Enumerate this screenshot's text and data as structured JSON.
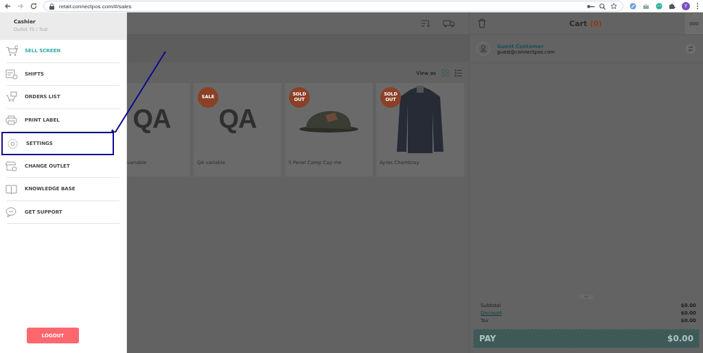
{
  "browser": {
    "url": "retail.connectpos.com/#/sales",
    "profile_initial": "Y"
  },
  "drawer": {
    "user": "Cashier",
    "outlet": "Outlet 75 / Test",
    "items": [
      {
        "label": "SELL SCREEN",
        "selected": true,
        "highlighted": false
      },
      {
        "label": "SHIFTS",
        "selected": false,
        "highlighted": false
      },
      {
        "label": "ORDERS LIST",
        "selected": false,
        "highlighted": false
      },
      {
        "label": "PRINT LABEL",
        "selected": false,
        "highlighted": false
      },
      {
        "label": "SETTINGS",
        "selected": false,
        "highlighted": true
      },
      {
        "label": "CHANGE OUTLET",
        "selected": false,
        "highlighted": false
      },
      {
        "label": "KNOWLEDGE BASE",
        "selected": false,
        "highlighted": false
      },
      {
        "label": "GET SUPPORT",
        "selected": false,
        "highlighted": false
      }
    ],
    "logout": "LOGOUT"
  },
  "products": {
    "view_as": "View as",
    "items": [
      {
        "name": "variable",
        "image_text": "QA"
      },
      {
        "name": "QA variable",
        "image_text": "QA",
        "badge": "SALE"
      },
      {
        "name": "5 Panel Camp Cap me",
        "badge": "SOLD OUT"
      },
      {
        "name": "Ayres Chambray",
        "badge": "SOLD OUT"
      }
    ]
  },
  "cart": {
    "title": "Cart",
    "count": "(0)",
    "customer": {
      "name": "Guest Customer",
      "email": "guest@connectpos.com"
    },
    "totals": [
      {
        "label": "Subtotal",
        "value": "$0.00",
        "kind": "plain"
      },
      {
        "label": "Discount",
        "value": "$0.00",
        "kind": "link"
      },
      {
        "label": "Tax",
        "value": "$0.00",
        "kind": "plain"
      }
    ],
    "pay": {
      "label": "PAY",
      "amount": "$0.00"
    }
  }
}
